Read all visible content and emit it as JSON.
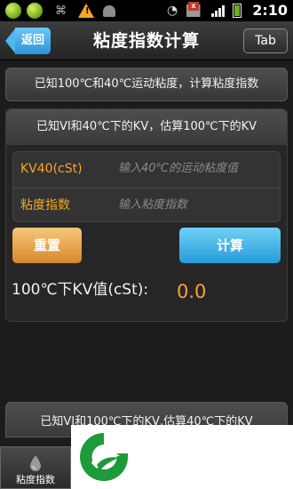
{
  "status_bar": {
    "time": "2:10",
    "icons": [
      "app-badge-icon",
      "app-badge-icon",
      "usb-icon",
      "warning-icon",
      "android-icon",
      "wifi-icon",
      "no-signal-icon",
      "signal-icon",
      "battery-icon"
    ]
  },
  "header": {
    "back_label": "返回",
    "title": "粘度指数计算",
    "tab_label": "Tab"
  },
  "sections": {
    "top": "已知100℃和40℃运动粘度，计算粘度指数",
    "middle": "已知VI和40℃下的KV，估算100℃下的KV",
    "bottom": "已知VI和100℃下的KV,估算40℃下的KV"
  },
  "form": {
    "kv40_label": "KV40(cSt)",
    "kv40_placeholder": "输入40℃的运动粘度值",
    "vi_label": "粘度指数",
    "vi_placeholder": "输入粘度指数",
    "reset_label": "重置",
    "calc_label": "计算",
    "result_label": "100℃下KV值(cSt):",
    "result_value": "0.0"
  },
  "bottom_nav": {
    "tab_label": "粘度指数"
  },
  "colors": {
    "accent_orange": "#f6a623",
    "accent_blue": "#279cd8",
    "logo_green": "#1e9a3a"
  }
}
